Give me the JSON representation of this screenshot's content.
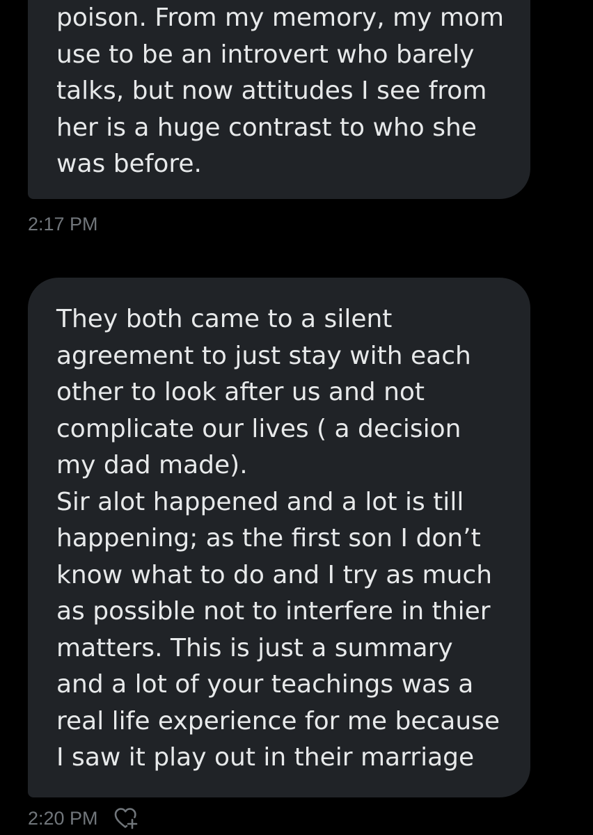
{
  "messages": [
    {
      "lines": [
        "poison. From my memory, my mom",
        "use to be an introvert who barely",
        "talks, but now attitudes I see from",
        "her is a huge contrast to who she",
        "was before."
      ],
      "timestamp": "2:17 PM"
    },
    {
      "lines": [
        "They both came to a silent",
        "agreement to just stay with each",
        "other to look after us and not",
        "complicate our lives ( a decision",
        "my dad made).",
        "Sir alot happened and a lot is till",
        "happening; as the first son I don’t",
        "know what to do and I try as much",
        "as possible not to interfere in thier",
        "matters. This is just a summary",
        "and a lot of your teachings was a",
        "real life experience for me because",
        "I saw it play out in their marriage"
      ],
      "timestamp": "2:20 PM",
      "reaction_icon": "heart-add-icon"
    }
  ],
  "colors": {
    "background": "#000000",
    "bubble": "#202327",
    "text": "#e7e9ea",
    "timestamp": "#71767b"
  }
}
